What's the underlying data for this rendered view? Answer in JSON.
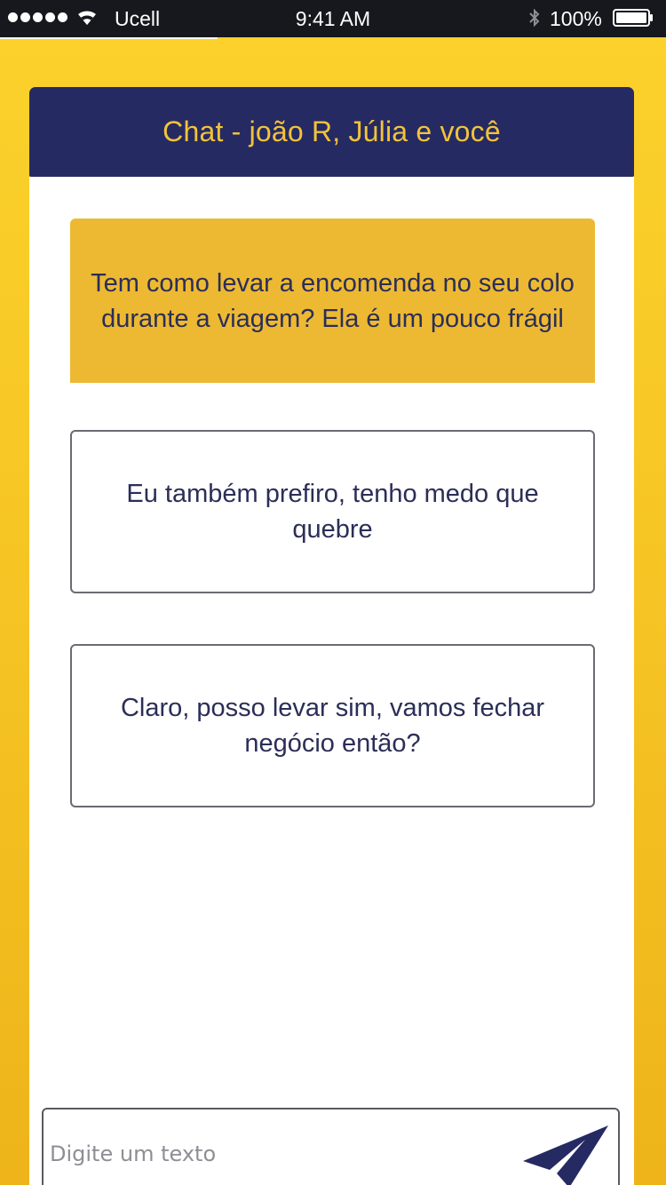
{
  "status_bar": {
    "carrier": "Ucell",
    "time": "9:41 AM",
    "battery": "100%",
    "icons": [
      "signal-dots-icon",
      "wifi-icon",
      "bluetooth-icon",
      "battery-icon"
    ]
  },
  "chat": {
    "title": "Chat - joão R, Júlia e você",
    "messages": [
      {
        "type": "incoming",
        "text": "Tem como levar a encomenda no seu colo durante a viagem? Ela é um pouco frágil"
      },
      {
        "type": "outgoing",
        "text": "Eu também prefiro, tenho medo que quebre"
      },
      {
        "type": "outgoing",
        "text": "Claro, posso levar sim, vamos fechar negócio então?"
      }
    ]
  },
  "composer": {
    "placeholder": "Digite um texto",
    "value": "",
    "send_icon": "send-paper-plane-icon"
  },
  "colors": {
    "background": "#f5c323",
    "header": "#262a62",
    "title_text": "#f2c33a",
    "incoming_bubble": "#edb933",
    "text": "#2b2e57"
  }
}
